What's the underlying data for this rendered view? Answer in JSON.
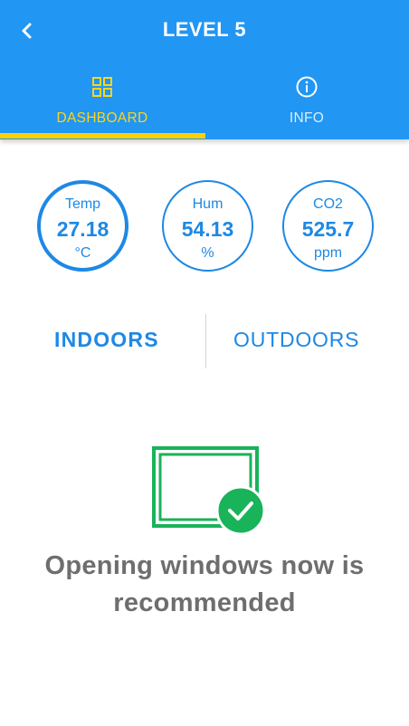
{
  "header": {
    "title": "LEVEL 5"
  },
  "tabs": [
    {
      "label": "DASHBOARD",
      "icon": "dashboard-icon",
      "active": true
    },
    {
      "label": "INFO",
      "icon": "info-icon",
      "active": false
    }
  ],
  "readings": [
    {
      "label": "Temp",
      "value": "27.18",
      "unit": "°C"
    },
    {
      "label": "Hum",
      "value": "54.13",
      "unit": "%"
    },
    {
      "label": "CO2",
      "value": "525.7",
      "unit": "ppm"
    }
  ],
  "location_toggle": {
    "indoors": "INDOORS",
    "outdoors": "OUTDOORS",
    "selected": "INDOORS"
  },
  "recommendation": {
    "line1": "Opening windows now is",
    "line2": "recommended",
    "icon": "window-check-icon"
  },
  "colors": {
    "primary": "#2196f3",
    "accent": "#ffd000",
    "gauge": "#1e88e5",
    "success": "#19b35a",
    "message_text": "#6e6e6e"
  }
}
